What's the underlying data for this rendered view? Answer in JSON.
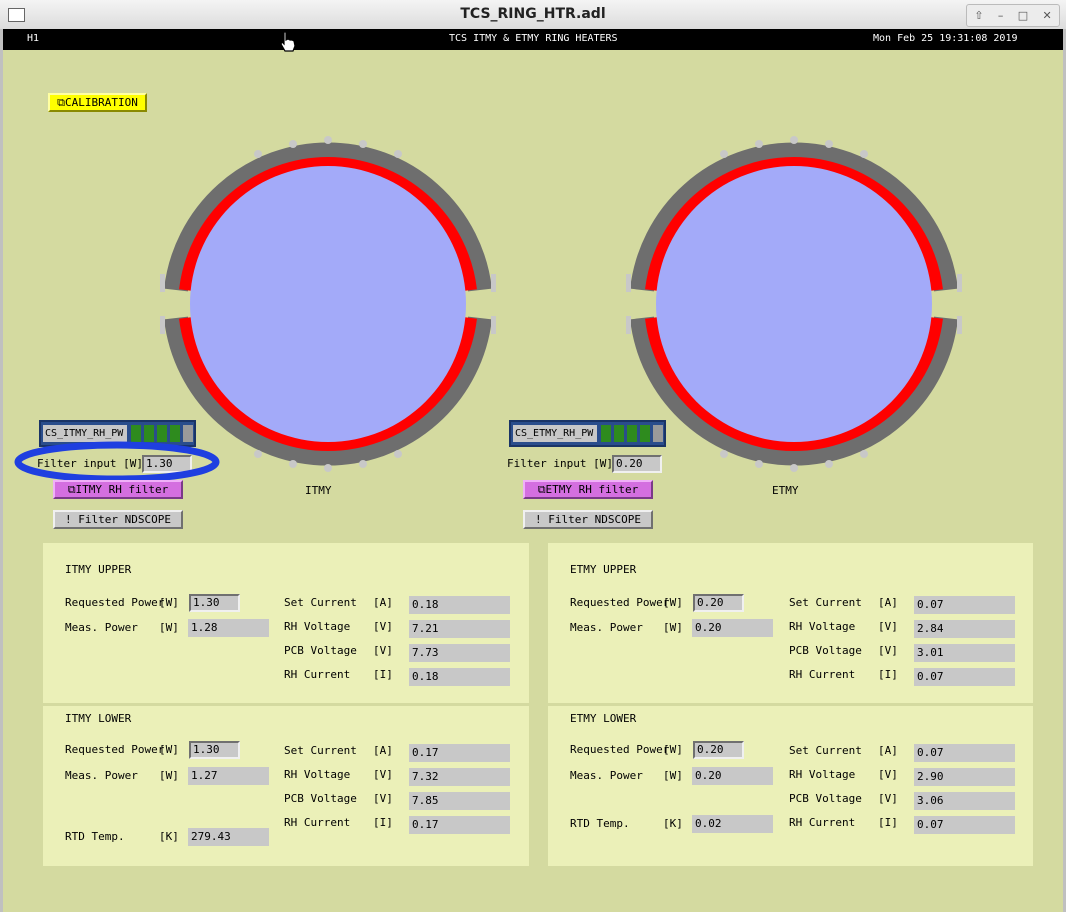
{
  "window": {
    "title": "TCS_RING_HTR.adl",
    "controls": [
      "⇧",
      "–",
      "□",
      "✕"
    ]
  },
  "header": {
    "site": "H1",
    "title": "TCS ITMY & ETMY RING HEATERS",
    "datetime": "Mon Feb 25 19:31:08 2019"
  },
  "calibration_button": "⧉CALIBRATION",
  "colors": {
    "background": "#d4daa0",
    "panel": "#ebf0b8",
    "ring": "#ff0000",
    "mirror": "#a3aaf9",
    "frame": "#6e6e6e",
    "highlight_ellipse": "#1f3fe0"
  },
  "optics": {
    "itmy": {
      "label": "ITMY",
      "power_widget": "CS_ITMY_RH_PW",
      "filter_input_label": "Filter input [W]",
      "filter_input_value": "1.30",
      "filter_button": "⧉ITMY RH filter",
      "ndscope_button": "! Filter NDSCOPE"
    },
    "etmy": {
      "label": "ETMY",
      "power_widget": "CS_ETMY_RH_PW",
      "filter_input_label": "Filter input [W]",
      "filter_input_value": "0.20",
      "filter_button": "⧉ETMY RH filter",
      "ndscope_button": "! Filter NDSCOPE"
    }
  },
  "labels": {
    "requested_power": "Requested Power",
    "unit_w": "[W]",
    "meas_power": "Meas. Power",
    "rtd_temp": "RTD Temp.",
    "unit_k": "[K]",
    "set_current": "Set Current",
    "unit_a": "[A]",
    "rh_voltage": "RH Voltage",
    "unit_v": "[V]",
    "pcb_voltage": "PCB Voltage",
    "rh_current": "RH Current",
    "unit_i": "[I]"
  },
  "panels": {
    "itmy_upper": {
      "title": "ITMY UPPER",
      "requested_power": "1.30",
      "meas_power": "1.28",
      "set_current": "0.18",
      "rh_voltage": "7.21",
      "pcb_voltage": "7.73",
      "rh_current": "0.18"
    },
    "itmy_lower": {
      "title": "ITMY LOWER",
      "requested_power": "1.30",
      "meas_power": "1.27",
      "rtd_temp": "279.43",
      "set_current": "0.17",
      "rh_voltage": "7.32",
      "pcb_voltage": "7.85",
      "rh_current": "0.17"
    },
    "etmy_upper": {
      "title": "ETMY UPPER",
      "requested_power": "0.20",
      "meas_power": "0.20",
      "set_current": "0.07",
      "rh_voltage": "2.84",
      "pcb_voltage": "3.01",
      "rh_current": "0.07"
    },
    "etmy_lower": {
      "title": "ETMY LOWER",
      "requested_power": "0.20",
      "meas_power": "0.20",
      "rtd_temp": "0.02",
      "set_current": "0.07",
      "rh_voltage": "2.90",
      "pcb_voltage": "3.06",
      "rh_current": "0.07"
    }
  }
}
